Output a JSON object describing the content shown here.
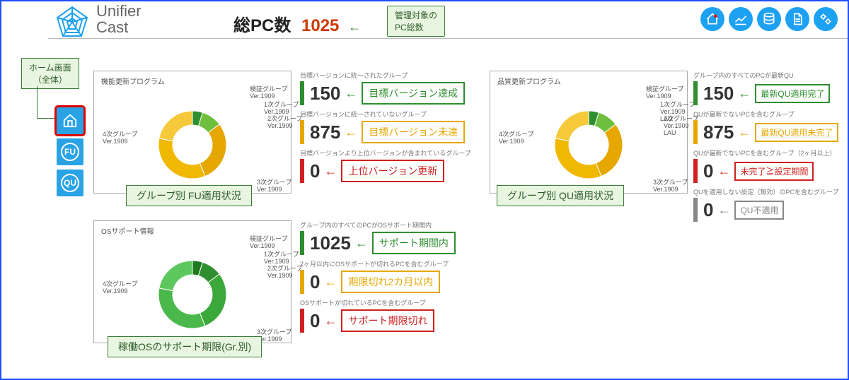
{
  "brand": {
    "line1": "Unifier",
    "line2": "Cast"
  },
  "header": {
    "total_label": "総PC数",
    "total_value": "1025",
    "total_note": "管理対象の\nPC総数"
  },
  "top_icons": [
    "dashboard-icon",
    "chart-icon",
    "database-icon",
    "document-icon",
    "settings-icon"
  ],
  "home_label": "ホーム画面\n（全体）",
  "nav": {
    "home": "home-icon",
    "fu": "FU",
    "qu": "QU"
  },
  "cards": {
    "fu": {
      "title": "機能更新プログラム",
      "callout": "グループ別 FU適用状況"
    },
    "qu": {
      "title": "品質更新プログラム",
      "callout": "グループ別 QU適用状況"
    },
    "os": {
      "title": "OSサポート情報",
      "callout": "稼働OSのサポート期限(Gr.別)"
    }
  },
  "donut_legend": [
    {
      "name": "検証グループ",
      "ver": "Ver.1909"
    },
    {
      "name": "1次グループ",
      "ver": "Ver.1909"
    },
    {
      "name": "2次グループ",
      "ver": "Ver.1909"
    },
    {
      "name": "3次グループ",
      "ver": "Ver.1909"
    },
    {
      "name": "4次グループ",
      "ver": "Ver.1909"
    }
  ],
  "donut_legend_qu_extra": "LAU",
  "metrics_fu": [
    {
      "title": "目標バージョンに統一されたグループ",
      "value": "150",
      "label": "目標バージョン達成",
      "color": "green"
    },
    {
      "title": "目標バージョンに統一されていないグループ",
      "value": "875",
      "label": "目標バージョン未達",
      "color": "amber"
    },
    {
      "title": "目標バージョンより上位バージョンが含まれているグループ",
      "value": "0",
      "label": "上位バージョン更新",
      "color": "red"
    }
  ],
  "metrics_qu": [
    {
      "title": "グループ内のすべてのPCが最新QU",
      "value": "150",
      "label": "最新QU適用完了",
      "color": "green"
    },
    {
      "title": "QUが最新でないPCを含むグループ",
      "value": "875",
      "label": "最新QU適用未完了",
      "color": "amber"
    },
    {
      "title": "QUが最新でないPCを含むグループ（2ヶ月以上）",
      "value": "0",
      "label": "未完了≧設定期間",
      "color": "red"
    },
    {
      "title": "QUを適用しない設定（無効）のPCを含むグループ",
      "value": "0",
      "label": "QU不適用",
      "color": "gray"
    }
  ],
  "metrics_os": [
    {
      "title": "グループ内のすべてのPCがOSサポート期間内",
      "value": "1025",
      "label": "サポート期間内",
      "color": "green"
    },
    {
      "title": "2ヶ月以内にOSサポートが切れるPCを含むグループ",
      "value": "0",
      "label": "期限切れ2カ月以内",
      "color": "amber"
    },
    {
      "title": "OSサポートが切れているPCを含むグループ",
      "value": "0",
      "label": "サポート期限切れ",
      "color": "red"
    }
  ],
  "chart_data": [
    {
      "type": "pie",
      "title": "機能更新プログラム",
      "series": [
        {
          "name": "検証グループ",
          "value": 50,
          "color": "#2f8f2f"
        },
        {
          "name": "1次グループ",
          "value": 100,
          "color": "#6fbf3f"
        },
        {
          "name": "2次グループ",
          "value": 300,
          "color": "#e6a700"
        },
        {
          "name": "3次グループ",
          "value": 350,
          "color": "#f0b800"
        },
        {
          "name": "4次グループ",
          "value": 225,
          "color": "#f5c93a"
        }
      ],
      "total": 1025
    },
    {
      "type": "pie",
      "title": "品質更新プログラム",
      "series": [
        {
          "name": "検証グループ",
          "value": 50,
          "color": "#2f8f2f"
        },
        {
          "name": "1次グループ",
          "value": 100,
          "color": "#6fbf3f"
        },
        {
          "name": "2次グループ",
          "value": 300,
          "color": "#e6a700"
        },
        {
          "name": "3次グループ",
          "value": 350,
          "color": "#f0b800"
        },
        {
          "name": "4次グループ",
          "value": 225,
          "color": "#f5c93a"
        }
      ],
      "total": 1025
    },
    {
      "type": "pie",
      "title": "OSサポート情報",
      "series": [
        {
          "name": "検証グループ",
          "value": 50,
          "color": "#1f7a1f"
        },
        {
          "name": "1次グループ",
          "value": 100,
          "color": "#2f8f2f"
        },
        {
          "name": "2次グループ",
          "value": 300,
          "color": "#3aa83a"
        },
        {
          "name": "3次グループ",
          "value": 350,
          "color": "#4bb84b"
        },
        {
          "name": "4次グループ",
          "value": 225,
          "color": "#5cc75c"
        }
      ],
      "total": 1025
    }
  ]
}
